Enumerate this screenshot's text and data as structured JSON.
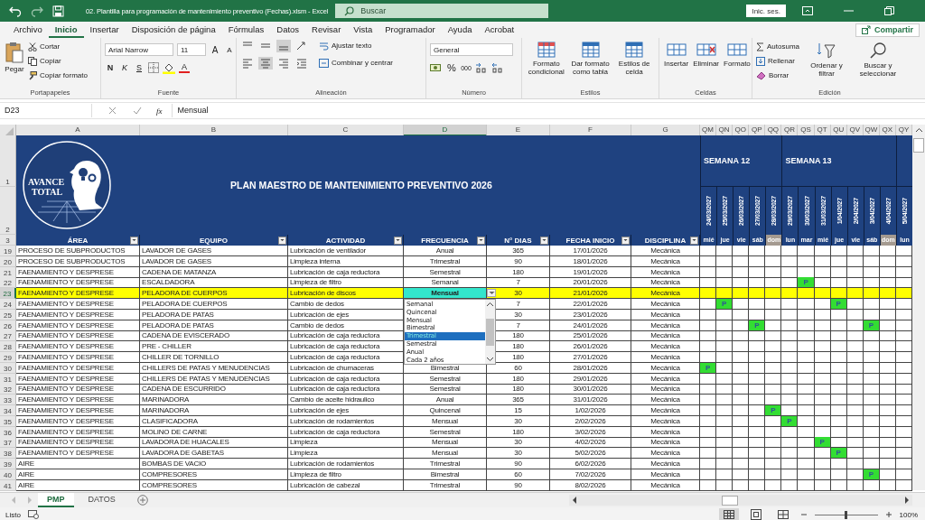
{
  "title_bar": {
    "title": "02. Plantilla para programación de mantenimiento preventivo (Fechas).xlsm  -  Excel",
    "search_placeholder": "Buscar",
    "signin": "Inic. ses."
  },
  "menu": [
    {
      "label": "Archivo",
      "selected": false
    },
    {
      "label": "Inicio",
      "selected": true
    },
    {
      "label": "Insertar",
      "selected": false
    },
    {
      "label": "Disposición de página",
      "selected": false
    },
    {
      "label": "Fórmulas",
      "selected": false
    },
    {
      "label": "Datos",
      "selected": false
    },
    {
      "label": "Revisar",
      "selected": false
    },
    {
      "label": "Vista",
      "selected": false
    },
    {
      "label": "Programador",
      "selected": false
    },
    {
      "label": "Ayuda",
      "selected": false
    },
    {
      "label": "Acrobat",
      "selected": false
    }
  ],
  "share": "Compartir",
  "ribbon": {
    "clipboard": {
      "label": "Portapapeles",
      "paste": "Pegar",
      "cut": "Cortar",
      "copy": "Copiar",
      "format_painter": "Copiar formato"
    },
    "font": {
      "label": "Fuente",
      "family": "Arial Narrow",
      "size": "11",
      "grow": "A",
      "shrink": "A",
      "bold": "N",
      "italic": "K",
      "underline": "S",
      "color_letter": "A"
    },
    "alignment": {
      "label": "Alineación",
      "vertical": [
        {
          "selected": false
        },
        {
          "selected": false
        },
        {
          "selected": true
        }
      ],
      "horizontal": [
        {
          "selected": false
        },
        {
          "selected": true
        },
        {
          "selected": false
        }
      ],
      "wrap": "Ajustar texto",
      "merge": "Combinar y centrar"
    },
    "number": {
      "label": "Número",
      "format": "General",
      "percent": "%",
      "thousands": "000"
    },
    "styles": {
      "label": "Estilos",
      "buttons": [
        "Formato condicional",
        "Dar formato como tabla",
        "Estilos de celda"
      ]
    },
    "cells": {
      "label": "Celdas",
      "buttons": [
        "Insertar",
        "Eliminar",
        "Formato"
      ]
    },
    "editing": {
      "label": "Edición",
      "autosum": "Autosuma",
      "fill": "Rellenar",
      "clear": "Borrar",
      "buttons": [
        "Ordenar y filtrar",
        "Buscar y seleccionar"
      ]
    }
  },
  "formula_bar": {
    "name_box": "D23",
    "fx": "fx",
    "value": "Mensual"
  },
  "columns": [
    {
      "letter": "A",
      "selected": false
    },
    {
      "letter": "B",
      "selected": false
    },
    {
      "letter": "C",
      "selected": false
    },
    {
      "letter": "D",
      "selected": true
    },
    {
      "letter": "E",
      "selected": false
    },
    {
      "letter": "F",
      "selected": false
    },
    {
      "letter": "G",
      "selected": false
    },
    {
      "letter": "QM",
      "selected": false
    },
    {
      "letter": "QN",
      "selected": false
    },
    {
      "letter": "QO",
      "selected": false
    },
    {
      "letter": "QP",
      "selected": false
    },
    {
      "letter": "QQ",
      "selected": false
    },
    {
      "letter": "QR",
      "selected": false
    },
    {
      "letter": "QS",
      "selected": false
    },
    {
      "letter": "QT",
      "selected": false
    },
    {
      "letter": "QU",
      "selected": false
    },
    {
      "letter": "QV",
      "selected": false
    },
    {
      "letter": "QW",
      "selected": false
    },
    {
      "letter": "QX",
      "selected": false
    },
    {
      "letter": "QY",
      "selected": false
    }
  ],
  "banner": {
    "rows": [
      "1",
      "2"
    ],
    "logo_lines": [
      "AVANCE",
      "TOTAL"
    ],
    "title": "PLAN MAESTRO DE MANTENIMIENTO PREVENTIVO 2026"
  },
  "weeks": [
    {
      "label": "SEMANA 12",
      "days": [
        {
          "date": "24/03/2027",
          "weekday": "mié",
          "shaded": false
        },
        {
          "date": "25/03/2027",
          "weekday": "jue",
          "shaded": false
        },
        {
          "date": "26/03/2027",
          "weekday": "vie",
          "shaded": false
        },
        {
          "date": "27/03/2027",
          "weekday": "sáb",
          "shaded": false
        },
        {
          "date": "28/03/2027",
          "weekday": "dom",
          "shaded": true
        }
      ]
    },
    {
      "label": "SEMANA 13",
      "days": [
        {
          "date": "29/03/2027",
          "weekday": "lun",
          "shaded": false
        },
        {
          "date": "30/03/2027",
          "weekday": "mar",
          "shaded": false
        },
        {
          "date": "31/03/2027",
          "weekday": "mié",
          "shaded": false
        },
        {
          "date": "1/04/2027",
          "weekday": "jue",
          "shaded": false
        },
        {
          "date": "2/04/2027",
          "weekday": "vie",
          "shaded": false
        },
        {
          "date": "3/04/2027",
          "weekday": "sáb",
          "shaded": false
        },
        {
          "date": "4/04/2027",
          "weekday": "dom",
          "shaded": true
        }
      ]
    },
    {
      "days": [
        {
          "date": "5/04/2027",
          "weekday": "lun",
          "shaded": false
        }
      ]
    }
  ],
  "table_header": {
    "row": "3",
    "headers": [
      "ÁREA",
      "EQUIPO",
      "ACTIVIDAD",
      "FRECUENCIA",
      "N° DIAS",
      "FECHA INICIO",
      "DISCIPLINA"
    ]
  },
  "rows": [
    {
      "row": "19",
      "area": "PROCESO DE SUBPRODUCTOS",
      "equipo": "LAVADOR DE GASES",
      "actividad": "Lubricación de ventilador",
      "frecuencia": "Anual",
      "dias": "365",
      "fecha": "17/01/2026",
      "disciplina": "Mecánica",
      "highlighted": false,
      "active": false,
      "days": [
        {
          "planned": false
        },
        {
          "planned": false
        },
        {
          "planned": false
        },
        {
          "planned": false
        },
        {
          "planned": false
        },
        {
          "planned": false
        },
        {
          "planned": false
        },
        {
          "planned": false
        },
        {
          "planned": false
        },
        {
          "planned": false
        },
        {
          "planned": false
        },
        {
          "planned": false
        },
        {
          "planned": false
        }
      ]
    },
    {
      "row": "20",
      "area": "PROCESO DE SUBPRODUCTOS",
      "equipo": "LAVADOR DE GASES",
      "actividad": "Limpieza interna",
      "frecuencia": "Trimestral",
      "dias": "90",
      "fecha": "18/01/2026",
      "disciplina": "Mecánica",
      "highlighted": false,
      "active": false,
      "days": [
        {
          "planned": false
        },
        {
          "planned": false
        },
        {
          "planned": false
        },
        {
          "planned": false
        },
        {
          "planned": false
        },
        {
          "planned": false
        },
        {
          "planned": false
        },
        {
          "planned": false
        },
        {
          "planned": false
        },
        {
          "planned": false
        },
        {
          "planned": false
        },
        {
          "planned": false
        },
        {
          "planned": false
        }
      ]
    },
    {
      "row": "21",
      "area": "FAENAMIENTO Y DESPRESE",
      "equipo": "CADENA DE MATANZA",
      "actividad": "Lubricación de caja reductora",
      "frecuencia": "Semestral",
      "dias": "180",
      "fecha": "19/01/2026",
      "disciplina": "Mecánica",
      "highlighted": false,
      "active": false,
      "days": [
        {
          "planned": false
        },
        {
          "planned": false
        },
        {
          "planned": false
        },
        {
          "planned": false
        },
        {
          "planned": false
        },
        {
          "planned": false
        },
        {
          "planned": false
        },
        {
          "planned": false
        },
        {
          "planned": false
        },
        {
          "planned": false
        },
        {
          "planned": false
        },
        {
          "planned": false
        },
        {
          "planned": false
        }
      ]
    },
    {
      "row": "22",
      "area": "FAENAMIENTO Y DESPRESE",
      "equipo": "ESCALDADORA",
      "actividad": "Limpieza de filtro",
      "frecuencia": "Semanal",
      "dias": "7",
      "fecha": "20/01/2026",
      "disciplina": "Mecánica",
      "highlighted": false,
      "active": false,
      "days": [
        {
          "planned": false
        },
        {
          "planned": false
        },
        {
          "planned": false
        },
        {
          "planned": false
        },
        {
          "planned": false
        },
        {
          "planned": false
        },
        {
          "planned": true,
          "mark": "P"
        },
        {
          "planned": false
        },
        {
          "planned": false
        },
        {
          "planned": false
        },
        {
          "planned": false
        },
        {
          "planned": false
        },
        {
          "planned": false
        }
      ]
    },
    {
      "row": "23",
      "area": "FAENAMIENTO Y DESPRESE",
      "equipo": "PELADORA DE CUERPOS",
      "actividad": "Lubricación de discos",
      "frecuencia": "Mensual",
      "dias": "30",
      "fecha": "21/01/2026",
      "disciplina": "Mecánica",
      "highlighted": true,
      "active": true,
      "days": [
        {
          "planned": false
        },
        {
          "planned": false
        },
        {
          "planned": false
        },
        {
          "planned": false
        },
        {
          "planned": false
        },
        {
          "planned": false
        },
        {
          "planned": false
        },
        {
          "planned": false
        },
        {
          "planned": false
        },
        {
          "planned": false
        },
        {
          "planned": false
        },
        {
          "planned": false
        },
        {
          "planned": false
        }
      ]
    },
    {
      "row": "24",
      "area": "FAENAMIENTO Y DESPRESE",
      "equipo": "PELADORA DE CUERPOS",
      "actividad": "Cambio de dedos",
      "dias": "7",
      "fecha": "22/01/2026",
      "disciplina": "Mecánica",
      "highlighted": false,
      "active": false,
      "days": [
        {
          "planned": false
        },
        {
          "planned": true,
          "mark": "P"
        },
        {
          "planned": false
        },
        {
          "planned": false
        },
        {
          "planned": false
        },
        {
          "planned": false
        },
        {
          "planned": false
        },
        {
          "planned": false
        },
        {
          "planned": true,
          "mark": "P"
        },
        {
          "planned": false
        },
        {
          "planned": false
        },
        {
          "planned": false
        },
        {
          "planned": false
        }
      ]
    },
    {
      "row": "25",
      "area": "FAENAMIENTO Y DESPRESE",
      "equipo": "PELADORA DE PATAS",
      "actividad": "Lubricación de ejes",
      "dias": "30",
      "fecha": "23/01/2026",
      "disciplina": "Mecánica",
      "highlighted": false,
      "active": false,
      "days": [
        {
          "planned": false
        },
        {
          "planned": false
        },
        {
          "planned": false
        },
        {
          "planned": false
        },
        {
          "planned": false
        },
        {
          "planned": false
        },
        {
          "planned": false
        },
        {
          "planned": false
        },
        {
          "planned": false
        },
        {
          "planned": false
        },
        {
          "planned": false
        },
        {
          "planned": false
        },
        {
          "planned": false
        }
      ]
    },
    {
      "row": "26",
      "area": "FAENAMIENTO Y DESPRESE",
      "equipo": "PELADORA DE PATAS",
      "actividad": "Cambio de dedos",
      "dias": "7",
      "fecha": "24/01/2026",
      "disciplina": "Mecánica",
      "highlighted": false,
      "active": false,
      "days": [
        {
          "planned": false
        },
        {
          "planned": false
        },
        {
          "planned": false
        },
        {
          "planned": true,
          "mark": "P"
        },
        {
          "planned": false
        },
        {
          "planned": false
        },
        {
          "planned": false
        },
        {
          "planned": false
        },
        {
          "planned": false
        },
        {
          "planned": false
        },
        {
          "planned": true,
          "mark": "P"
        },
        {
          "planned": false
        },
        {
          "planned": false
        }
      ]
    },
    {
      "row": "27",
      "area": "FAENAMIENTO Y DESPRESE",
      "equipo": "CADENA DE EVISCERADO",
      "actividad": "Lubricación de caja reductora",
      "dias": "180",
      "fecha": "25/01/2026",
      "disciplina": "Mecánica",
      "highlighted": false,
      "active": false,
      "days": [
        {
          "planned": false
        },
        {
          "planned": false
        },
        {
          "planned": false
        },
        {
          "planned": false
        },
        {
          "planned": false
        },
        {
          "planned": false
        },
        {
          "planned": false
        },
        {
          "planned": false
        },
        {
          "planned": false
        },
        {
          "planned": false
        },
        {
          "planned": false
        },
        {
          "planned": false
        },
        {
          "planned": false
        }
      ]
    },
    {
      "row": "28",
      "area": "FAENAMIENTO Y DESPRESE",
      "equipo": "PRE - CHILLER",
      "actividad": "Lubricación de caja reductora",
      "dias": "180",
      "fecha": "26/01/2026",
      "disciplina": "Mecánica",
      "highlighted": false,
      "active": false,
      "days": [
        {
          "planned": false
        },
        {
          "planned": false
        },
        {
          "planned": false
        },
        {
          "planned": false
        },
        {
          "planned": false
        },
        {
          "planned": false
        },
        {
          "planned": false
        },
        {
          "planned": false
        },
        {
          "planned": false
        },
        {
          "planned": false
        },
        {
          "planned": false
        },
        {
          "planned": false
        },
        {
          "planned": false
        }
      ]
    },
    {
      "row": "29",
      "area": "FAENAMIENTO Y DESPRESE",
      "equipo": "CHILLER DE TORNILLO",
      "actividad": "Lubricación de caja reductora",
      "dias": "180",
      "fecha": "27/01/2026",
      "disciplina": "Mecánica",
      "highlighted": false,
      "active": false,
      "days": [
        {
          "planned": false
        },
        {
          "planned": false
        },
        {
          "planned": false
        },
        {
          "planned": false
        },
        {
          "planned": false
        },
        {
          "planned": false
        },
        {
          "planned": false
        },
        {
          "planned": false
        },
        {
          "planned": false
        },
        {
          "planned": false
        },
        {
          "planned": false
        },
        {
          "planned": false
        },
        {
          "planned": false
        }
      ]
    },
    {
      "row": "30",
      "area": "FAENAMIENTO Y DESPRESE",
      "equipo": "CHILLERS DE PATAS Y MENUDENCIAS",
      "actividad": "Lubricación de chumaceras",
      "frecuencia": "Bimestral",
      "dias": "60",
      "fecha": "28/01/2026",
      "disciplina": "Mecánica",
      "highlighted": false,
      "active": false,
      "days": [
        {
          "planned": true,
          "mark": "P"
        },
        {
          "planned": false
        },
        {
          "planned": false
        },
        {
          "planned": false
        },
        {
          "planned": false
        },
        {
          "planned": false
        },
        {
          "planned": false
        },
        {
          "planned": false
        },
        {
          "planned": false
        },
        {
          "planned": false
        },
        {
          "planned": false
        },
        {
          "planned": false
        },
        {
          "planned": false
        }
      ]
    },
    {
      "row": "31",
      "area": "FAENAMIENTO Y DESPRESE",
      "equipo": "CHILLERS DE PATAS Y MENUDENCIAS",
      "actividad": "Lubricación de caja reductora",
      "frecuencia": "Semestral",
      "dias": "180",
      "fecha": "29/01/2026",
      "disciplina": "Mecánica",
      "highlighted": false,
      "active": false,
      "days": [
        {
          "planned": false
        },
        {
          "planned": false
        },
        {
          "planned": false
        },
        {
          "planned": false
        },
        {
          "planned": false
        },
        {
          "planned": false
        },
        {
          "planned": false
        },
        {
          "planned": false
        },
        {
          "planned": false
        },
        {
          "planned": false
        },
        {
          "planned": false
        },
        {
          "planned": false
        },
        {
          "planned": false
        }
      ]
    },
    {
      "row": "32",
      "area": "FAENAMIENTO Y DESPRESE",
      "equipo": "CADENA DE ESCURRIDO",
      "actividad": "Lubricación de caja reductora",
      "frecuencia": "Semestral",
      "dias": "180",
      "fecha": "30/01/2026",
      "disciplina": "Mecánica",
      "highlighted": false,
      "active": false,
      "days": [
        {
          "planned": false
        },
        {
          "planned": false
        },
        {
          "planned": false
        },
        {
          "planned": false
        },
        {
          "planned": false
        },
        {
          "planned": false
        },
        {
          "planned": false
        },
        {
          "planned": false
        },
        {
          "planned": false
        },
        {
          "planned": false
        },
        {
          "planned": false
        },
        {
          "planned": false
        },
        {
          "planned": false
        }
      ]
    },
    {
      "row": "33",
      "area": "FAENAMIENTO Y DESPRESE",
      "equipo": "MARINADORA",
      "actividad": "Cambio de aceite hidraulico",
      "frecuencia": "Anual",
      "dias": "365",
      "fecha": "31/01/2026",
      "disciplina": "Mecánica",
      "highlighted": false,
      "active": false,
      "days": [
        {
          "planned": false
        },
        {
          "planned": false
        },
        {
          "planned": false
        },
        {
          "planned": false
        },
        {
          "planned": false
        },
        {
          "planned": false
        },
        {
          "planned": false
        },
        {
          "planned": false
        },
        {
          "planned": false
        },
        {
          "planned": false
        },
        {
          "planned": false
        },
        {
          "planned": false
        },
        {
          "planned": false
        }
      ]
    },
    {
      "row": "34",
      "area": "FAENAMIENTO Y DESPRESE",
      "equipo": "MARINADORA",
      "actividad": "Lubricación de ejes",
      "frecuencia": "Quincenal",
      "dias": "15",
      "fecha": "1/02/2026",
      "disciplina": "Mecánica",
      "highlighted": false,
      "active": false,
      "days": [
        {
          "planned": false
        },
        {
          "planned": false
        },
        {
          "planned": false
        },
        {
          "planned": false
        },
        {
          "planned": true,
          "mark": "P"
        },
        {
          "planned": false
        },
        {
          "planned": false
        },
        {
          "planned": false
        },
        {
          "planned": false
        },
        {
          "planned": false
        },
        {
          "planned": false
        },
        {
          "planned": false
        },
        {
          "planned": false
        }
      ]
    },
    {
      "row": "35",
      "area": "FAENAMIENTO Y DESPRESE",
      "equipo": "CLASIFICADORA",
      "actividad": "Lubricación de rodamientos",
      "frecuencia": "Mensual",
      "dias": "30",
      "fecha": "2/02/2026",
      "disciplina": "Mecánica",
      "highlighted": false,
      "active": false,
      "days": [
        {
          "planned": false
        },
        {
          "planned": false
        },
        {
          "planned": false
        },
        {
          "planned": false
        },
        {
          "planned": false
        },
        {
          "planned": true,
          "mark": "P"
        },
        {
          "planned": false
        },
        {
          "planned": false
        },
        {
          "planned": false
        },
        {
          "planned": false
        },
        {
          "planned": false
        },
        {
          "planned": false
        },
        {
          "planned": false
        }
      ]
    },
    {
      "row": "36",
      "area": "FAENAMIENTO Y DESPRESE",
      "equipo": "MOLINO DE CARNE",
      "actividad": "Lubricación de caja reductora",
      "frecuencia": "Semestral",
      "dias": "180",
      "fecha": "3/02/2026",
      "disciplina": "Mecánica",
      "highlighted": false,
      "active": false,
      "days": [
        {
          "planned": false
        },
        {
          "planned": false
        },
        {
          "planned": false
        },
        {
          "planned": false
        },
        {
          "planned": false
        },
        {
          "planned": false
        },
        {
          "planned": false
        },
        {
          "planned": false
        },
        {
          "planned": false
        },
        {
          "planned": false
        },
        {
          "planned": false
        },
        {
          "planned": false
        },
        {
          "planned": false
        }
      ]
    },
    {
      "row": "37",
      "area": "FAENAMIENTO Y DESPRESE",
      "equipo": "LAVADORA DE HUACALES",
      "actividad": "Limpieza",
      "frecuencia": "Mensual",
      "dias": "30",
      "fecha": "4/02/2026",
      "disciplina": "Mecánica",
      "highlighted": false,
      "active": false,
      "days": [
        {
          "planned": false
        },
        {
          "planned": false
        },
        {
          "planned": false
        },
        {
          "planned": false
        },
        {
          "planned": false
        },
        {
          "planned": false
        },
        {
          "planned": false
        },
        {
          "planned": true,
          "mark": "P"
        },
        {
          "planned": false
        },
        {
          "planned": false
        },
        {
          "planned": false
        },
        {
          "planned": false
        },
        {
          "planned": false
        }
      ]
    },
    {
      "row": "38",
      "area": "FAENAMIENTO Y DESPRESE",
      "equipo": "LAVADORA DE GABETAS",
      "actividad": "Limpieza",
      "frecuencia": "Mensual",
      "dias": "30",
      "fecha": "5/02/2026",
      "disciplina": "Mecánica",
      "highlighted": false,
      "active": false,
      "days": [
        {
          "planned": false
        },
        {
          "planned": false
        },
        {
          "planned": false
        },
        {
          "planned": false
        },
        {
          "planned": false
        },
        {
          "planned": false
        },
        {
          "planned": false
        },
        {
          "planned": false
        },
        {
          "planned": true,
          "mark": "P"
        },
        {
          "planned": false
        },
        {
          "planned": false
        },
        {
          "planned": false
        },
        {
          "planned": false
        }
      ]
    },
    {
      "row": "39",
      "area": "AIRE",
      "equipo": "BOMBAS DE VACIO",
      "actividad": "Lubricación de rodamientos",
      "frecuencia": "Trimestral",
      "dias": "90",
      "fecha": "6/02/2026",
      "disciplina": "Mecánica",
      "highlighted": false,
      "active": false,
      "days": [
        {
          "planned": false
        },
        {
          "planned": false
        },
        {
          "planned": false
        },
        {
          "planned": false
        },
        {
          "planned": false
        },
        {
          "planned": false
        },
        {
          "planned": false
        },
        {
          "planned": false
        },
        {
          "planned": false
        },
        {
          "planned": false
        },
        {
          "planned": false
        },
        {
          "planned": false
        },
        {
          "planned": false
        }
      ]
    },
    {
      "row": "40",
      "area": "AIRE",
      "equipo": "COMPRESORES",
      "actividad": "Limpieza de filtro",
      "frecuencia": "Bimestral",
      "dias": "60",
      "fecha": "7/02/2026",
      "disciplina": "Mecánica",
      "highlighted": false,
      "active": false,
      "days": [
        {
          "planned": false
        },
        {
          "planned": false
        },
        {
          "planned": false
        },
        {
          "planned": false
        },
        {
          "planned": false
        },
        {
          "planned": false
        },
        {
          "planned": false
        },
        {
          "planned": false
        },
        {
          "planned": false
        },
        {
          "planned": false
        },
        {
          "planned": true,
          "mark": "P"
        },
        {
          "planned": false
        },
        {
          "planned": false
        }
      ]
    },
    {
      "row": "41",
      "area": "AIRE",
      "equipo": "COMPRESORES",
      "actividad": "Lubricación de cabezal",
      "frecuencia": "Trimestral",
      "dias": "90",
      "fecha": "8/02/2026",
      "disciplina": "Mecánica",
      "highlighted": false,
      "active": false,
      "days": [
        {
          "planned": false
        },
        {
          "planned": false
        },
        {
          "planned": false
        },
        {
          "planned": false
        },
        {
          "planned": false
        },
        {
          "planned": false
        },
        {
          "planned": false
        },
        {
          "planned": false
        },
        {
          "planned": false
        },
        {
          "planned": false
        },
        {
          "planned": false
        },
        {
          "planned": false
        },
        {
          "planned": false
        }
      ]
    }
  ],
  "dropdown": {
    "options": [
      {
        "label": "Semanal",
        "selected": false
      },
      {
        "label": "Quincenal",
        "selected": false
      },
      {
        "label": "Mensual",
        "selected": false
      },
      {
        "label": "Bimestral",
        "selected": false
      },
      {
        "label": "Trimestral",
        "selected": true
      },
      {
        "label": "Semestral",
        "selected": false
      },
      {
        "label": "Anual",
        "selected": false
      },
      {
        "label": "Cada 2 años",
        "selected": false
      }
    ]
  },
  "sheet_tabs": [
    {
      "label": "PMP",
      "selected": true
    },
    {
      "label": "DATOS",
      "selected": false
    }
  ],
  "status_bar": {
    "status": "Listo",
    "zoom": "100%",
    "zoom_level": {
      "level": 0.5
    }
  }
}
